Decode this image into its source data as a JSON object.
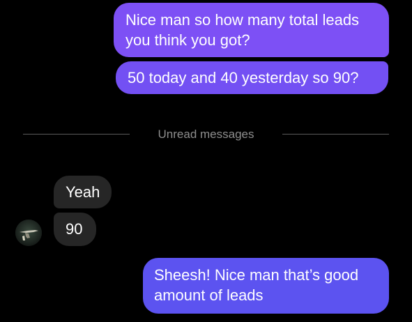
{
  "colors": {
    "background": "#000000",
    "outgoing_top": "#7d50f5",
    "outgoing_mid": "#7350f3",
    "outgoing_bottom": "#5c53f0",
    "incoming": "#262626",
    "divider": "#5c5c5c",
    "divider_text": "#8e8e8e"
  },
  "messages": [
    {
      "direction": "outgoing",
      "lines": [
        "Nice man so how many total leads",
        "you think you got?"
      ]
    },
    {
      "direction": "outgoing",
      "lines": [
        "50 today and 40 yesterday so 90?"
      ]
    },
    {
      "direction": "incoming",
      "lines": [
        "Yeah"
      ]
    },
    {
      "direction": "incoming",
      "lines": [
        "90"
      ]
    },
    {
      "direction": "outgoing",
      "lines": [
        "Sheesh! Nice man that’s good",
        "amount of leads"
      ]
    }
  ],
  "divider": {
    "label": "Unread messages"
  },
  "avatar_icon": "profile-photo"
}
